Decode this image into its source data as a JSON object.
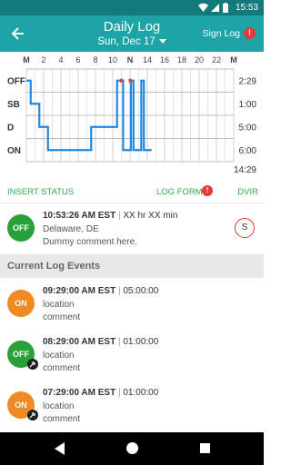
{
  "status_bar": {
    "time": "15:53"
  },
  "app_bar": {
    "title": "Daily Log",
    "date": "Sun, Dec 17",
    "sign_label": "Sign Log",
    "alert": "!"
  },
  "chart_data": {
    "type": "line",
    "hour_labels": [
      "M",
      "2",
      "4",
      "6",
      "8",
      "10",
      "N",
      "14",
      "16",
      "18",
      "20",
      "22",
      "M"
    ],
    "rows": [
      "OFF",
      "SB",
      "D",
      "ON"
    ],
    "row_totals": [
      "2:29",
      "1:00",
      "5:00",
      "6:00"
    ],
    "grand_total": "14:29",
    "accent": "#1e88e5",
    "segments": [
      {
        "status": "OFF",
        "start": 0,
        "end": 0.5
      },
      {
        "status": "SB",
        "start": 0.5,
        "end": 1.5
      },
      {
        "status": "D",
        "start": 1.5,
        "end": 2.5
      },
      {
        "status": "ON",
        "start": 2.5,
        "end": 7.5
      },
      {
        "status": "D",
        "start": 7.5,
        "end": 10.5
      },
      {
        "status": "OFF",
        "start": 10.5,
        "end": 11.2
      },
      {
        "status": "ON",
        "start": 11.2,
        "end": 12.1
      },
      {
        "status": "OFF",
        "start": 12.1,
        "end": 12.4
      },
      {
        "status": "ON",
        "start": 12.4,
        "end": 13.3
      },
      {
        "status": "OFF",
        "start": 13.3,
        "end": 13.6
      },
      {
        "status": "ON",
        "start": 13.6,
        "end": 14.5
      }
    ],
    "markers": [
      {
        "hour": 11.0,
        "color": "#e53935"
      },
      {
        "hour": 12.0,
        "color": "#e53935"
      }
    ]
  },
  "toolbar": {
    "insert_status": "INSERT STATUS",
    "log_form": "LOG FORM",
    "log_form_alert": "!",
    "dvir": "DVIR"
  },
  "current_status": {
    "badge": "OFF",
    "time": "10:53:26 AM EST",
    "sep": " | ",
    "duration": "XX hr XX min",
    "location": "Delaware, DE",
    "comment": "Dummy comment here.",
    "sign_button": "S"
  },
  "section_title": "Current Log Events",
  "events": [
    {
      "badge": "ON",
      "color": "orange",
      "time": "09:29:00 AM EST",
      "duration": "05:00:00",
      "location": "location",
      "comment": "comment",
      "plug": false
    },
    {
      "badge": "OFF",
      "color": "green",
      "time": "08:29:00 AM EST",
      "duration": "01:00:00",
      "location": "location",
      "comment": "comment",
      "plug": true
    },
    {
      "badge": "ON",
      "color": "orange",
      "time": "07:29:00 AM EST",
      "duration": "01:00:00",
      "location": "location",
      "comment": "comment",
      "plug": true
    }
  ],
  "event_sep": " | "
}
